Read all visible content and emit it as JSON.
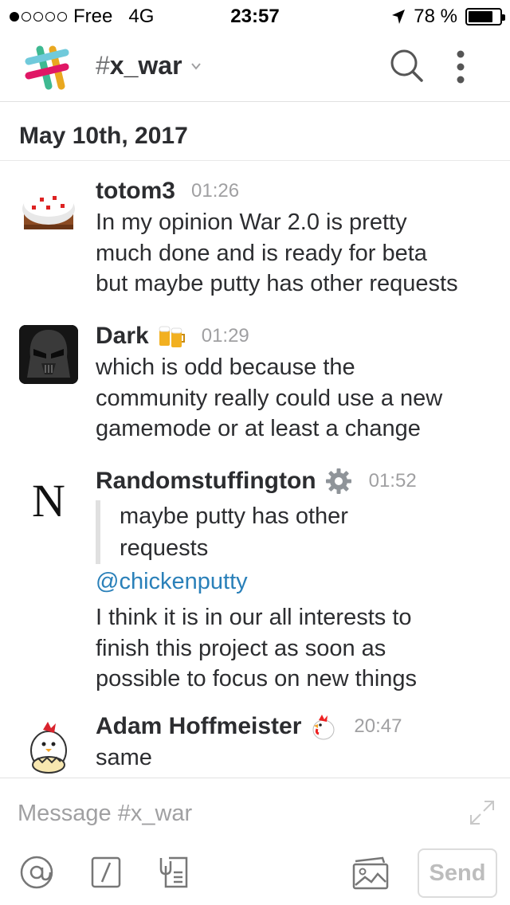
{
  "status_bar": {
    "carrier": "Free",
    "network": "4G",
    "time": "23:57",
    "battery": "78 %",
    "battery_level": 0.78,
    "signal_bars": 1
  },
  "header": {
    "channel_hash": "#",
    "channel_name": "x_war",
    "icons": [
      "slack-logo",
      "chevron-down-icon",
      "search-icon",
      "more-vertical-icon"
    ]
  },
  "date_separator": "May 10th, 2017",
  "messages": [
    {
      "author": "totom3",
      "time": "01:26",
      "avatar": "cake-avatar",
      "lines": [
        "In my opinion War 2.0 is pretty",
        "much done and is ready for beta",
        "but maybe putty has other requests"
      ]
    },
    {
      "author": "Dark",
      "status_emoji": "beers-emoji",
      "time": "01:29",
      "avatar": "dark-helmet-avatar",
      "lines": [
        "which is odd because the",
        "community really could use a new",
        "gamemode or at least a change"
      ]
    },
    {
      "author": "Randomstuffington",
      "status_emoji": "gear-emoji",
      "time": "01:52",
      "avatar": "letter-n-avatar",
      "quote_lines": [
        "maybe putty has other",
        "requests"
      ],
      "mention": "@chickenputty",
      "lines": [
        "I think it is in our all interests to",
        "finish this project as soon as",
        "possible to focus on new things"
      ]
    },
    {
      "author": "Adam Hoffmeister",
      "status_emoji": "rooster-emoji",
      "time": "20:47",
      "avatar": "chick-avatar",
      "lines": [
        "same"
      ]
    }
  ],
  "composer": {
    "placeholder": "Message #x_war",
    "send_label": "Send",
    "icons": [
      "at-icon",
      "slash-command-icon",
      "snippet-icon",
      "photo-icon",
      "expand-icon"
    ]
  },
  "colors": {
    "link": "#2a80b9",
    "muted": "#a0a0a2",
    "text": "#2c2d30",
    "divider": "#e1e1e1"
  }
}
